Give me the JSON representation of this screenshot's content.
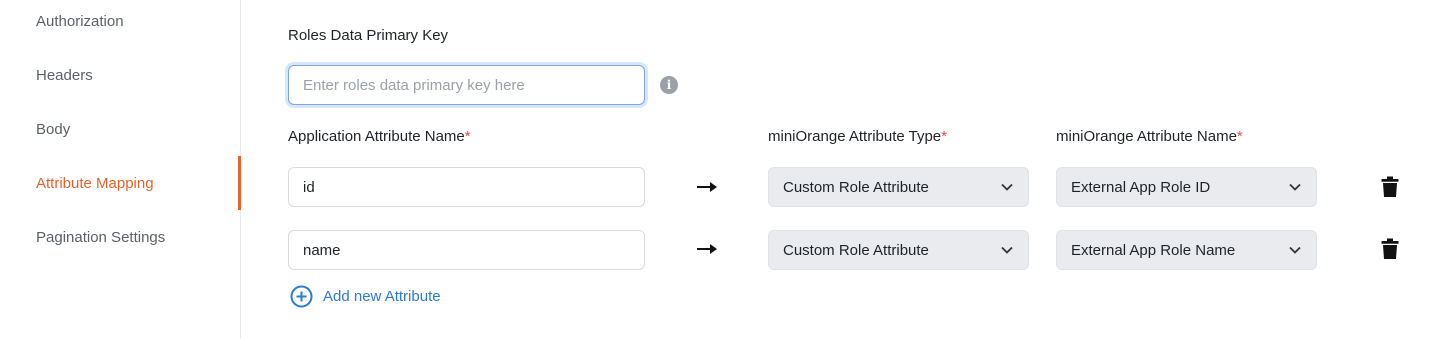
{
  "sidebar": {
    "items": [
      {
        "label": "Authorization",
        "active": false
      },
      {
        "label": "Headers",
        "active": false
      },
      {
        "label": "Body",
        "active": false
      },
      {
        "label": "Attribute Mapping",
        "active": true
      },
      {
        "label": "Pagination Settings",
        "active": false
      }
    ]
  },
  "form": {
    "primary_key_label": "Roles Data Primary Key",
    "primary_key_placeholder": "Enter roles data primary key here",
    "primary_key_value": "",
    "columns": {
      "app_attr_name": "Application Attribute Name",
      "mo_attr_type": "miniOrange Attribute Type",
      "mo_attr_name": "miniOrange Attribute Name",
      "required_marker": "*"
    },
    "rows": [
      {
        "app_attr": "id",
        "attr_type": "Custom Role Attribute",
        "attr_name": "External App Role ID"
      },
      {
        "app_attr": "name",
        "attr_type": "Custom Role Attribute",
        "attr_name": "External App Role Name"
      }
    ],
    "add_label": "Add new Attribute"
  },
  "colors": {
    "accent": "#e8622a",
    "link": "#2a7bd6",
    "required": "#e5484d"
  }
}
